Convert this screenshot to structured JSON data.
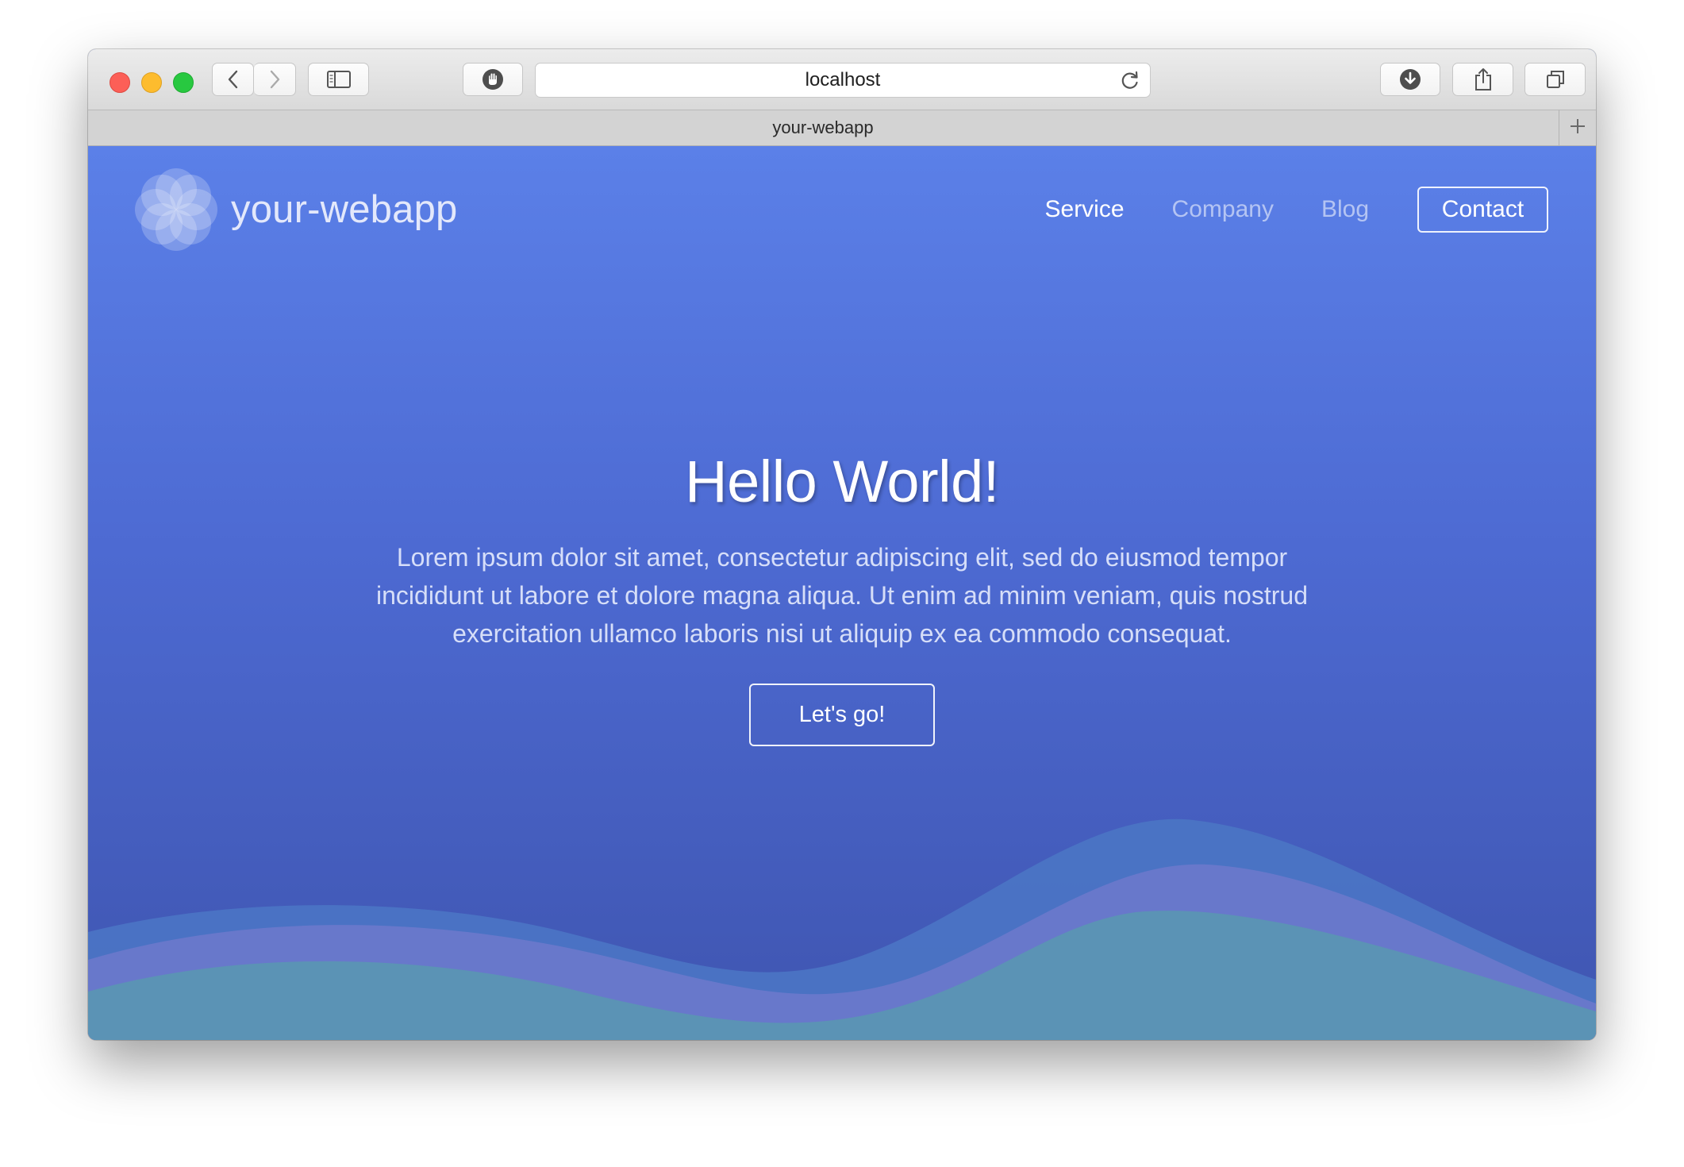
{
  "browser": {
    "address": "localhost",
    "tab_title": "your-webapp",
    "icons": [
      "back-icon",
      "forward-icon",
      "sidebar-icon",
      "privacy-shield-icon",
      "reload-icon",
      "download-icon",
      "share-icon",
      "tabs-overview-icon",
      "plus-icon"
    ]
  },
  "site": {
    "brand": "your-webapp",
    "nav": {
      "service": "Service",
      "company": "Company",
      "blog": "Blog",
      "contact": "Contact"
    },
    "hero": {
      "title": "Hello World!",
      "text": "Lorem ipsum dolor sit amet, consectetur adipiscing elit, sed do eiusmod tempor incididunt ut labore et dolore magna aliqua. Ut enim ad minim veniam, quis nostrud exercitation ullamco laboris nisi ut aliquip ex ea commodo consequat.",
      "button": "Let's go!"
    }
  },
  "colors": {
    "gradient_top": "#5b80e8",
    "gradient_bottom": "#3f55b0",
    "wave_back": "#4a74c4",
    "wave_middle": "#6b79cc",
    "wave_front": "#5b93b5"
  }
}
